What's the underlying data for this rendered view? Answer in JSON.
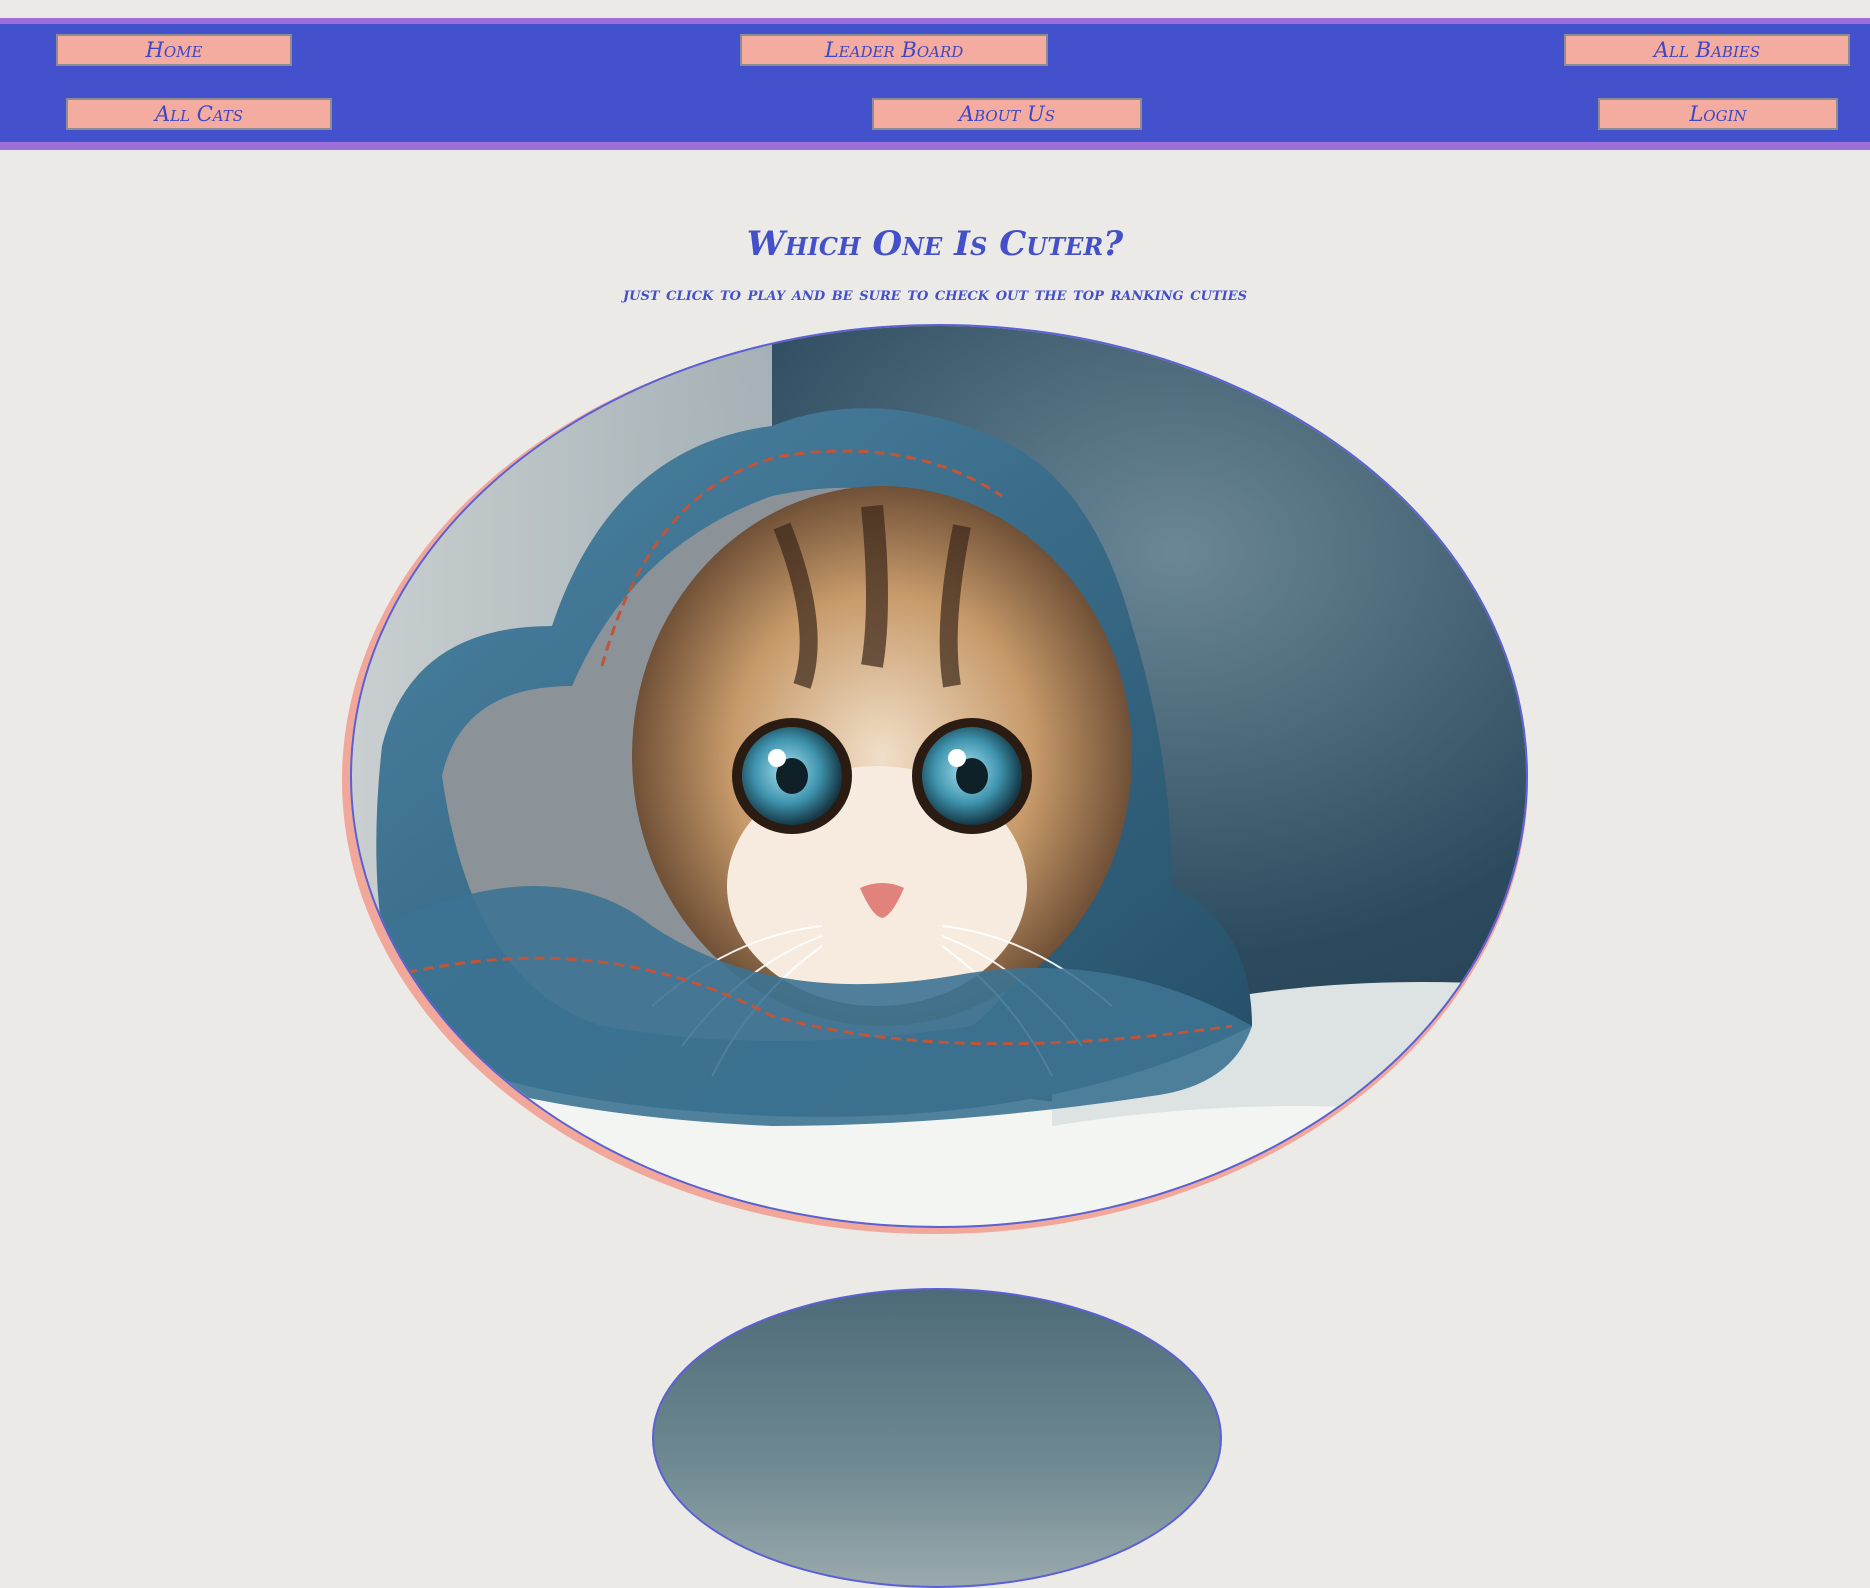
{
  "nav": {
    "home": "Home",
    "leader_board": "Leader Board",
    "all_babies": "All Babies",
    "all_cats": "All Cats",
    "about_us": "About Us",
    "login": "Login"
  },
  "main": {
    "title": "Which One Is Cuter?",
    "subtitle": "just click to play and be sure to check out the top ranking cuties"
  },
  "images": {
    "first": "kitten-in-denim-photo",
    "second": "second-candidate-photo"
  },
  "colors": {
    "background": "#eceae6",
    "navbar": "#4451cd",
    "navbar_border": "#9f6fd9",
    "button_fill": "#f4aba0",
    "accent_text": "#4350c9"
  }
}
